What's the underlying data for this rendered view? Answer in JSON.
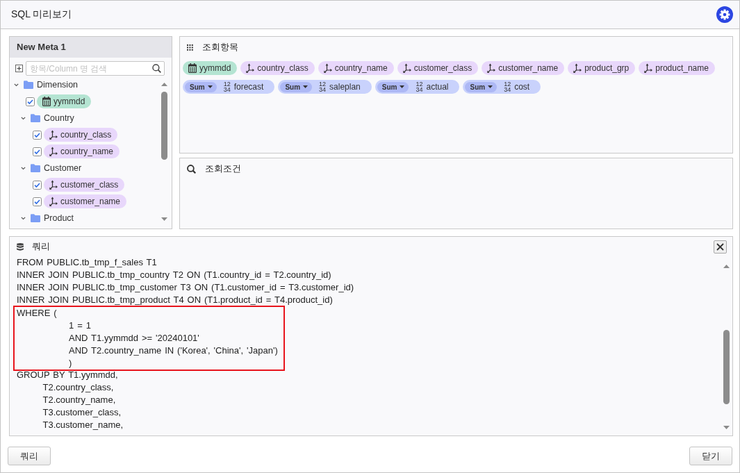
{
  "window": {
    "title": "SQL 미리보기"
  },
  "meta_panel": {
    "title": "New Meta 1",
    "search": {
      "placeholder": "항목/Column 명 검색"
    },
    "tree": [
      {
        "label": "Dimension",
        "kind": "folder",
        "expanded": true,
        "children": [
          {
            "label": "yymmdd",
            "kind": "date",
            "checked": true
          },
          {
            "label": "Country",
            "kind": "folder",
            "expanded": true,
            "children": [
              {
                "label": "country_class",
                "kind": "dimension",
                "checked": true
              },
              {
                "label": "country_name",
                "kind": "dimension",
                "checked": true
              }
            ]
          },
          {
            "label": "Customer",
            "kind": "folder",
            "expanded": true,
            "children": [
              {
                "label": "customer_class",
                "kind": "dimension",
                "checked": true
              },
              {
                "label": "customer_name",
                "kind": "dimension",
                "checked": true
              }
            ]
          },
          {
            "label": "Product",
            "kind": "folder",
            "expanded": true
          }
        ]
      }
    ]
  },
  "select_panel": {
    "title": "조회항목",
    "chip_rows": [
      [
        {
          "label": "yymmdd",
          "kind": "date"
        },
        {
          "label": "country_class",
          "kind": "dimension"
        },
        {
          "label": "country_name",
          "kind": "dimension"
        },
        {
          "label": "customer_class",
          "kind": "dimension"
        },
        {
          "label": "customer_name",
          "kind": "dimension"
        },
        {
          "label": "product_grp",
          "kind": "dimension"
        },
        {
          "label": "product_name",
          "kind": "dimension"
        }
      ],
      [
        {
          "label": "forecast",
          "kind": "measure",
          "aggregate": "Sum",
          "type_digits": [
            "12",
            "34"
          ]
        },
        {
          "label": "saleplan",
          "kind": "measure",
          "aggregate": "Sum",
          "type_digits": [
            "12",
            "34"
          ]
        },
        {
          "label": "actual",
          "kind": "measure",
          "aggregate": "Sum",
          "type_digits": [
            "12",
            "34"
          ]
        },
        {
          "label": "cost",
          "kind": "measure",
          "aggregate": "Sum",
          "type_digits": [
            "12",
            "34"
          ]
        }
      ]
    ]
  },
  "filter_panel": {
    "title": "조회조건"
  },
  "query_panel": {
    "title": "쿼리",
    "blocks": [
      {
        "highlighted": false,
        "lines": [
          "FROM PUBLIC.tb_tmp_f_sales T1",
          "INNER JOIN PUBLIC.tb_tmp_country T2 ON (T1.country_id = T2.country_id)",
          "INNER JOIN PUBLIC.tb_tmp_customer T3 ON (T1.customer_id = T3.customer_id)",
          "INNER JOIN PUBLIC.tb_tmp_product T4 ON (T1.product_id = T4.product_id)"
        ]
      },
      {
        "highlighted": true,
        "lines": [
          "WHERE (",
          "\t\t1 = 1",
          "\t\tAND T1.yymmdd >= '20240101'",
          "\t\tAND T2.country_name IN ('Korea', 'China', 'Japan')",
          "\t\t)"
        ]
      },
      {
        "highlighted": false,
        "lines": [
          "GROUP BY T1.yymmdd,",
          "\tT2.country_class,",
          "\tT2.country_name,",
          "\tT3.customer_class,",
          "\tT3.customer_name,"
        ]
      }
    ]
  },
  "footer": {
    "query_button": "쿼리",
    "close_button": "닫기"
  }
}
